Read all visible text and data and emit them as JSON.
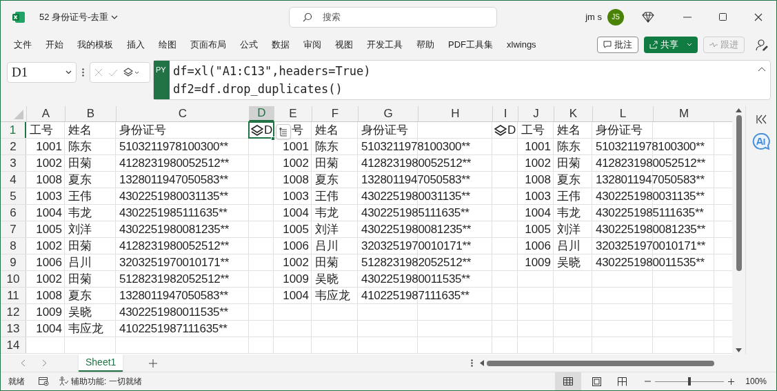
{
  "title_bar": {
    "document_title": "52 身份证号-去重",
    "search": {
      "placeholder": "搜索"
    },
    "user_name": "jm s",
    "avatar_initials": "JS"
  },
  "ribbon_tabs": [
    {
      "label": "文件"
    },
    {
      "label": "开始"
    },
    {
      "label": "我的模板"
    },
    {
      "label": "插入"
    },
    {
      "label": "绘图"
    },
    {
      "label": "页面布局"
    },
    {
      "label": "公式"
    },
    {
      "label": "数据"
    },
    {
      "label": "审阅"
    },
    {
      "label": "视图"
    },
    {
      "label": "开发工具"
    },
    {
      "label": "帮助"
    },
    {
      "label": "PDF工具集"
    },
    {
      "label": "xlwings"
    }
  ],
  "ribbon_buttons": [
    {
      "kind": "comments",
      "label": "批注",
      "disabled": false
    },
    {
      "kind": "share",
      "label": "共享",
      "disabled": false
    },
    {
      "kind": "follow",
      "label": "跟进",
      "disabled": true
    }
  ],
  "formula_bar": {
    "name_box": "D1",
    "badge": "PY",
    "lines": [
      "df=xl(\"A1:C13\",headers=True)",
      "df2=df.drop_duplicates()"
    ]
  },
  "columns": [
    {
      "label": "A",
      "selected": false
    },
    {
      "label": "B",
      "selected": false
    },
    {
      "label": "C",
      "selected": false
    },
    {
      "label": "D",
      "selected": true
    },
    {
      "label": "E",
      "selected": false
    },
    {
      "label": "F",
      "selected": false
    },
    {
      "label": "G",
      "selected": false
    },
    {
      "label": "H",
      "selected": false
    },
    {
      "label": "I",
      "selected": false
    },
    {
      "label": "J",
      "selected": false
    },
    {
      "label": "K",
      "selected": false
    },
    {
      "label": "L",
      "selected": false
    },
    {
      "label": "M",
      "selected": false
    }
  ],
  "rows": [
    {
      "number": "1",
      "selected": true,
      "kind": "header",
      "cells": [
        "工号",
        "姓名",
        "身份证号",
        {
          "kind": "python-object",
          "text": "D"
        },
        "号",
        "姓名",
        "身份证号",
        "",
        {
          "kind": "python-object",
          "text": "D"
        },
        "工号",
        "姓名",
        "身份证号",
        ""
      ]
    },
    {
      "number": "2",
      "selected": false,
      "kind": "data",
      "cells": [
        "1001",
        "陈东",
        "5103211978100300**",
        "",
        "1001",
        "陈东",
        "5103211978100300**",
        "",
        "",
        "1001",
        "陈东",
        "5103211978100300**",
        ""
      ]
    },
    {
      "number": "3",
      "selected": false,
      "kind": "data",
      "cells": [
        "1002",
        "田菊",
        "4128231980052512**",
        "",
        "1002",
        "田菊",
        "4128231980052512**",
        "",
        "",
        "1002",
        "田菊",
        "4128231980052512**",
        ""
      ]
    },
    {
      "number": "4",
      "selected": false,
      "kind": "data",
      "cells": [
        "1008",
        "夏东",
        "1328011947050583**",
        "",
        "1008",
        "夏东",
        "1328011947050583**",
        "",
        "",
        "1008",
        "夏东",
        "1328011947050583**",
        ""
      ]
    },
    {
      "number": "5",
      "selected": false,
      "kind": "data",
      "cells": [
        "1003",
        "王伟",
        "4302251980031135**",
        "",
        "1003",
        "王伟",
        "4302251980031135**",
        "",
        "",
        "1003",
        "王伟",
        "4302251980031135**",
        ""
      ]
    },
    {
      "number": "6",
      "selected": false,
      "kind": "data",
      "cells": [
        "1004",
        "韦龙",
        "4302251985111635**",
        "",
        "1004",
        "韦龙",
        "4302251985111635**",
        "",
        "",
        "1004",
        "韦龙",
        "4302251985111635**",
        ""
      ]
    },
    {
      "number": "7",
      "selected": false,
      "kind": "data",
      "cells": [
        "1005",
        "刘洋",
        "4302251980081235**",
        "",
        "1005",
        "刘洋",
        "4302251980081235**",
        "",
        "",
        "1005",
        "刘洋",
        "4302251980081235**",
        ""
      ]
    },
    {
      "number": "8",
      "selected": false,
      "kind": "data",
      "cells": [
        "1002",
        "田菊",
        "4128231980052512**",
        "",
        "1006",
        "吕川",
        "3203251970010171**",
        "",
        "",
        "1006",
        "吕川",
        "3203251970010171**",
        ""
      ]
    },
    {
      "number": "9",
      "selected": false,
      "kind": "data",
      "cells": [
        "1006",
        "吕川",
        "3203251970010171**",
        "",
        "1002",
        "田菊",
        "5128231982052512**",
        "",
        "",
        "1009",
        "吴晓",
        "4302251980011535**",
        ""
      ]
    },
    {
      "number": "10",
      "selected": false,
      "kind": "data",
      "cells": [
        "1002",
        "田菊",
        "5128231982052512**",
        "",
        "1009",
        "吴晓",
        "4302251980011535**",
        "",
        "",
        "",
        "",
        "",
        ""
      ]
    },
    {
      "number": "11",
      "selected": false,
      "kind": "data",
      "cells": [
        "1008",
        "夏东",
        "1328011947050583**",
        "",
        "1004",
        "韦应龙",
        "4102251987111635**",
        "",
        "",
        "",
        "",
        "",
        ""
      ]
    },
    {
      "number": "12",
      "selected": false,
      "kind": "data",
      "cells": [
        "1009",
        "吴晓",
        "4302251980011535**",
        "",
        "",
        "",
        "",
        "",
        "",
        "",
        "",
        "",
        ""
      ]
    },
    {
      "number": "13",
      "selected": false,
      "kind": "data",
      "cells": [
        "1004",
        "韦应龙",
        "4102251987111635**",
        "",
        "",
        "",
        "",
        "",
        "",
        "",
        "",
        "",
        ""
      ]
    },
    {
      "number": "14",
      "selected": false,
      "kind": "data",
      "cells": [
        "",
        "",
        "",
        "",
        "",
        "",
        "",
        "",
        "",
        "",
        "",
        "",
        ""
      ]
    }
  ],
  "sheet_tabs": [
    {
      "label": "Sheet1",
      "selected": true
    }
  ],
  "status_bar": {
    "status": "就绪",
    "accessibility": "辅助功能: 一切就绪",
    "zoom": "100%",
    "zoom_slider": {
      "level": 0.5
    }
  }
}
